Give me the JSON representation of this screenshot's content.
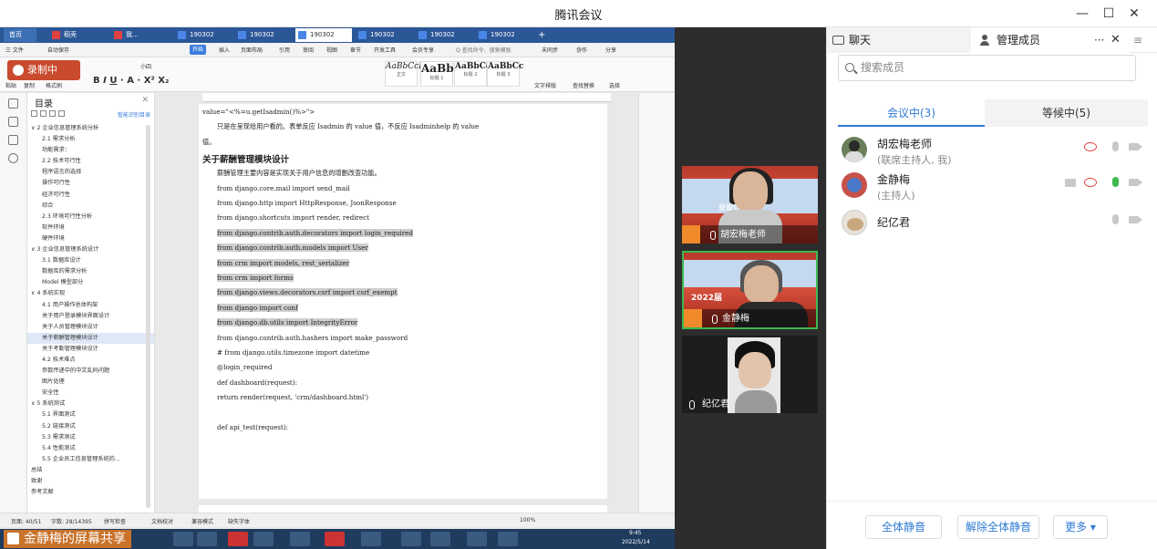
{
  "window": {
    "title": "腾讯会议",
    "minimize": "—",
    "maximize": "☐",
    "close": "✕"
  },
  "share": {
    "presenter_label": "金静梅的屏幕共享",
    "recording_label": "录制中",
    "tabs": [
      "首页",
      "稻壳",
      "我...",
      "190302",
      "190302",
      "190302",
      "190302",
      "190302",
      "190302"
    ],
    "menu": [
      "三 文件",
      "自动保存",
      "开始",
      "插入",
      "页面布局",
      "引用",
      "审阅",
      "视图",
      "章节",
      "开发工具",
      "会员专享",
      "Q 查找命令、搜索模板",
      "未同步",
      "协作",
      "分享"
    ],
    "ribbon": {
      "styles": [
        {
          "sample": "AaBbCcI",
          "name": "正文"
        },
        {
          "sample": "AaBb(",
          "name": "标题 1"
        },
        {
          "sample": "AaBbCcI",
          "name": "标题 2"
        },
        {
          "sample": "AaBbCc",
          "name": "标题 3"
        }
      ],
      "font_size": "小四",
      "paste": "粘贴",
      "copy": "复制",
      "format_painter": "格式刷",
      "text_layout": "文字排版",
      "find_replace": "查找替换",
      "select": "选择"
    },
    "toc": {
      "title": "目录",
      "smart": "智能识别目录",
      "items": [
        {
          "level": 1,
          "text": "∨ 2 企业信息管理系统分析"
        },
        {
          "level": 2,
          "text": "2.1 需求分析"
        },
        {
          "level": 2,
          "text": "功能需求："
        },
        {
          "level": 2,
          "text": "2.2 技术可行性"
        },
        {
          "level": 2,
          "text": "程序语言的选择"
        },
        {
          "level": 2,
          "text": "操作可行性"
        },
        {
          "level": 2,
          "text": "经济可行性"
        },
        {
          "level": 2,
          "text": "综合"
        },
        {
          "level": 2,
          "text": "2.3 环境可行性分析"
        },
        {
          "level": 2,
          "text": "软件环境"
        },
        {
          "level": 2,
          "text": "硬件环境"
        },
        {
          "level": 1,
          "text": "∨ 3 企业信息管理系统设计"
        },
        {
          "level": 2,
          "text": "3.1 数据库设计"
        },
        {
          "level": 2,
          "text": "数据库的需求分析"
        },
        {
          "level": 2,
          "text": "Model 模型部分"
        },
        {
          "level": 1,
          "text": "∨ 4 系统实现"
        },
        {
          "level": 2,
          "text": "4.1 用户操作总体构架"
        },
        {
          "level": 2,
          "text": "关于用户登录模块界面设计"
        },
        {
          "level": 2,
          "text": "关于人员管理模块设计"
        },
        {
          "level": 2,
          "text": "关于薪酬管理模块设计",
          "selected": true
        },
        {
          "level": 2,
          "text": "关于考勤管理模块设计"
        },
        {
          "level": 2,
          "text": "4.2 技术难点"
        },
        {
          "level": 2,
          "text": "参数传递中的中文乱码问题"
        },
        {
          "level": 2,
          "text": "图片处理"
        },
        {
          "level": 2,
          "text": "安全性"
        },
        {
          "level": 1,
          "text": "∨ 5 系统测试"
        },
        {
          "level": 2,
          "text": "5.1 界面测试"
        },
        {
          "level": 2,
          "text": "5.2 链接测试"
        },
        {
          "level": 2,
          "text": "5.3 需求测试"
        },
        {
          "level": 2,
          "text": "5.4 性能测试"
        },
        {
          "level": 2,
          "text": "5.5 企业员工信息管理系统的..."
        },
        {
          "level": 1,
          "text": "总结"
        },
        {
          "level": 1,
          "text": "致谢"
        },
        {
          "level": 1,
          "text": "参考文献"
        }
      ]
    },
    "doc": {
      "lines": [
        {
          "text": "value=\"<%=u.getIsadmin()%>\">",
          "style": "code"
        },
        {
          "text": "只是在呈现给用户看的。表单反应 Isadmin 的 value 值，不反应 Isadminhelp 的 value",
          "style": "body"
        },
        {
          "text": "值。",
          "style": "body"
        },
        {
          "text": "关于薪酬管理模块设计",
          "style": "heading"
        },
        {
          "text": "薪酬管理主要内容是实现关于用户信息的增删改查功能。",
          "style": "body"
        },
        {
          "text": "from django.core.mail import send_mail",
          "style": "code"
        },
        {
          "text": "from django.http import HttpResponse,  JsonResponse",
          "style": "code"
        },
        {
          "text": "from django.shortcuts import render,  redirect",
          "style": "code"
        },
        {
          "text": "from django.contrib.auth.decorators import login_required",
          "style": "hl"
        },
        {
          "text": "from django.contrib.auth.models import User",
          "style": "hl"
        },
        {
          "text": "from crm import models,  rest_serializer",
          "style": "hl"
        },
        {
          "text": "from crm import forms",
          "style": "hl"
        },
        {
          "text": "from django.views.decorators.csrf import csrf_exempt",
          "style": "hl"
        },
        {
          "text": "from django import conf",
          "style": "hl"
        },
        {
          "text": "from django.db.utils import IntegrityError",
          "style": "hl"
        },
        {
          "text": "from django.contrib.auth.hashers import make_password",
          "style": "code"
        },
        {
          "text": "# from django.utils.timezone import datetime",
          "style": "code"
        },
        {
          "text": "@login_required",
          "style": "code"
        },
        {
          "text": "def dashboard(request):",
          "style": "code"
        },
        {
          "text": "    return render(request,  'crm/dashboard.html')",
          "style": "code"
        },
        {
          "text": "",
          "style": "code"
        },
        {
          "text": "def api_test(request):",
          "style": "code"
        }
      ]
    },
    "status": {
      "page": "页面: 40/51",
      "words": "字数: 28/14395",
      "spell": "拼写检查",
      "proof": "文档校对",
      "compat": "兼容模式",
      "font_missing": "缺失字体",
      "zoom": "100%"
    },
    "taskbar": {
      "time": "9:45",
      "date": "2022/5/14"
    }
  },
  "videos": [
    {
      "name": "胡宏梅老师",
      "banner": "业设计答辩",
      "camera_on": true,
      "active": false
    },
    {
      "name": "金静梅",
      "banner": "2022届",
      "camera_on": true,
      "active": true
    },
    {
      "name": "纪亿君",
      "camera_on": true,
      "active": false
    }
  ],
  "panel": {
    "tab_chat": "聊天",
    "tab_members": "管理成员",
    "more": "···",
    "close": "✕",
    "menu": "≡",
    "search_placeholder": "搜索成员",
    "tab_in_meeting": "会议中(3)",
    "tab_waiting": "等候中(5)",
    "members": [
      {
        "name": "胡宏梅老师",
        "role": "(联席主持人, 我)",
        "share": false,
        "mic_on": false
      },
      {
        "name": "金静梅",
        "role": "(主持人)",
        "share": true,
        "mic_on": true
      },
      {
        "name": "纪亿君",
        "role": "",
        "share": false,
        "mic_on": false
      }
    ],
    "mute_all": "全体静音",
    "unmute_all": "解除全体静音",
    "more_btn": "更多 ▾"
  },
  "colors": {
    "accent": "#2e7ad6",
    "active_border": "#3db94f",
    "share_orange": "#c8722a"
  }
}
